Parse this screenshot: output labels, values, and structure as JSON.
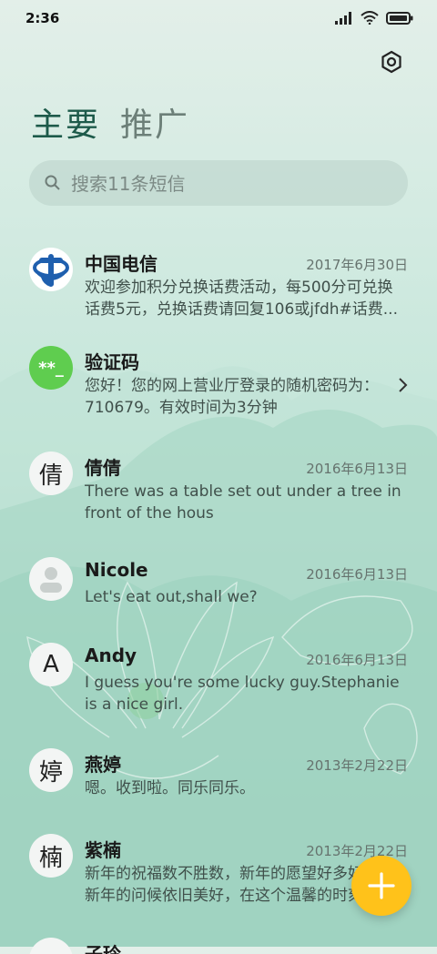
{
  "status_bar": {
    "time": "2:36"
  },
  "tabs": [
    {
      "label": "主要"
    },
    {
      "label": "推广"
    }
  ],
  "search": {
    "placeholder": "搜索11条短信",
    "value": ""
  },
  "conversations": [
    {
      "name": "中国电信",
      "date": "2017年6月30日",
      "preview": "欢迎参加积分兑换话费活动，每500分可兑换话费5元，兑换话费请回复106或jfdh#话费..."
    },
    {
      "name": "验证码",
      "date": "",
      "preview": "您好！您的网上营业厅登录的随机密码为：710679。有效时间为3分钟",
      "avatar_text": "**_"
    },
    {
      "name": "倩倩",
      "date": "2016年6月13日",
      "preview": "There was a table set out under a tree in front of the hous",
      "avatar_text": "倩"
    },
    {
      "name": "Nicole",
      "date": "2016年6月13日",
      "preview": "Let's eat out,shall we?"
    },
    {
      "name": "Andy",
      "date": "2016年6月13日",
      "preview": "I guess you're some lucky guy.Stephanie is a nice girl.",
      "avatar_text": "A"
    },
    {
      "name": "燕婷",
      "date": "2013年2月22日",
      "preview": "嗯。收到啦。同乐同乐。",
      "avatar_text": "婷"
    },
    {
      "name": "紫楠",
      "date": "2013年2月22日",
      "preview": "新年的祝福数不胜数，新年的愿望好多好多，新年的问候依旧美好，在这个温馨的时刻",
      "avatar_text": "楠"
    },
    {
      "name": "子玲",
      "date": "",
      "preview": ""
    }
  ],
  "colors": {
    "accent": "#1d5a4a",
    "fab": "#ffc21a",
    "verify_avatar": "#5fcd4f",
    "telecom_blue": "#1f5fae"
  }
}
